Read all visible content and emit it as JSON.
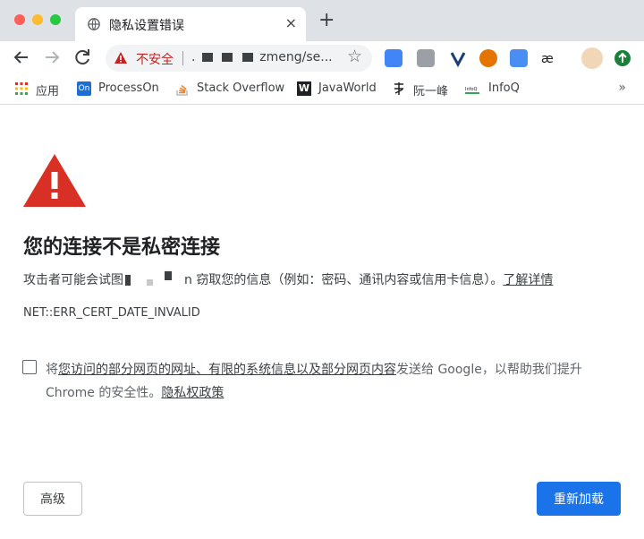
{
  "tab": {
    "title": "隐私设置错误",
    "close_label": "×",
    "new_tab_label": "+"
  },
  "address_bar": {
    "security_label": "不安全",
    "url_prefix": ".",
    "url_text": "zmeng/se..."
  },
  "bookmarks": [
    {
      "label": "应用",
      "icon": "apps-grid-icon"
    },
    {
      "label": "ProcessOn",
      "icon": "processon-icon"
    },
    {
      "label": "Stack Overflow",
      "icon": "stackoverflow-icon"
    },
    {
      "label": "JavaWorld",
      "icon": "javaworld-icon"
    },
    {
      "label": "阮一峰",
      "icon": "ruanyifeng-icon"
    },
    {
      "label": "InfoQ",
      "icon": "infoq-icon"
    }
  ],
  "bookmarks_more": "»",
  "page": {
    "heading": "您的连接不是私密连接",
    "desc_prefix": "攻击者可能会试图",
    "desc_mid": "n 窃取您的信息（例如：密码、通讯内容或信用卡信息）。",
    "learn_more": "了解详情",
    "error_code": "NET::ERR_CERT_DATE_INVALID",
    "optin_prefix": "将",
    "optin_link": "您访问的部分网页的网址、有限的系统信息以及部分网页内容",
    "optin_suffix": "发送给 Google，以帮助我们提升",
    "optin_line2": "Chrome 的安全性。",
    "privacy_link": "隐私权政策"
  },
  "buttons": {
    "advanced": "高级",
    "reload": "重新加载"
  },
  "colors": {
    "primary": "#1a73e8",
    "danger": "#c5221f",
    "warning_triangle": "#d93025"
  }
}
